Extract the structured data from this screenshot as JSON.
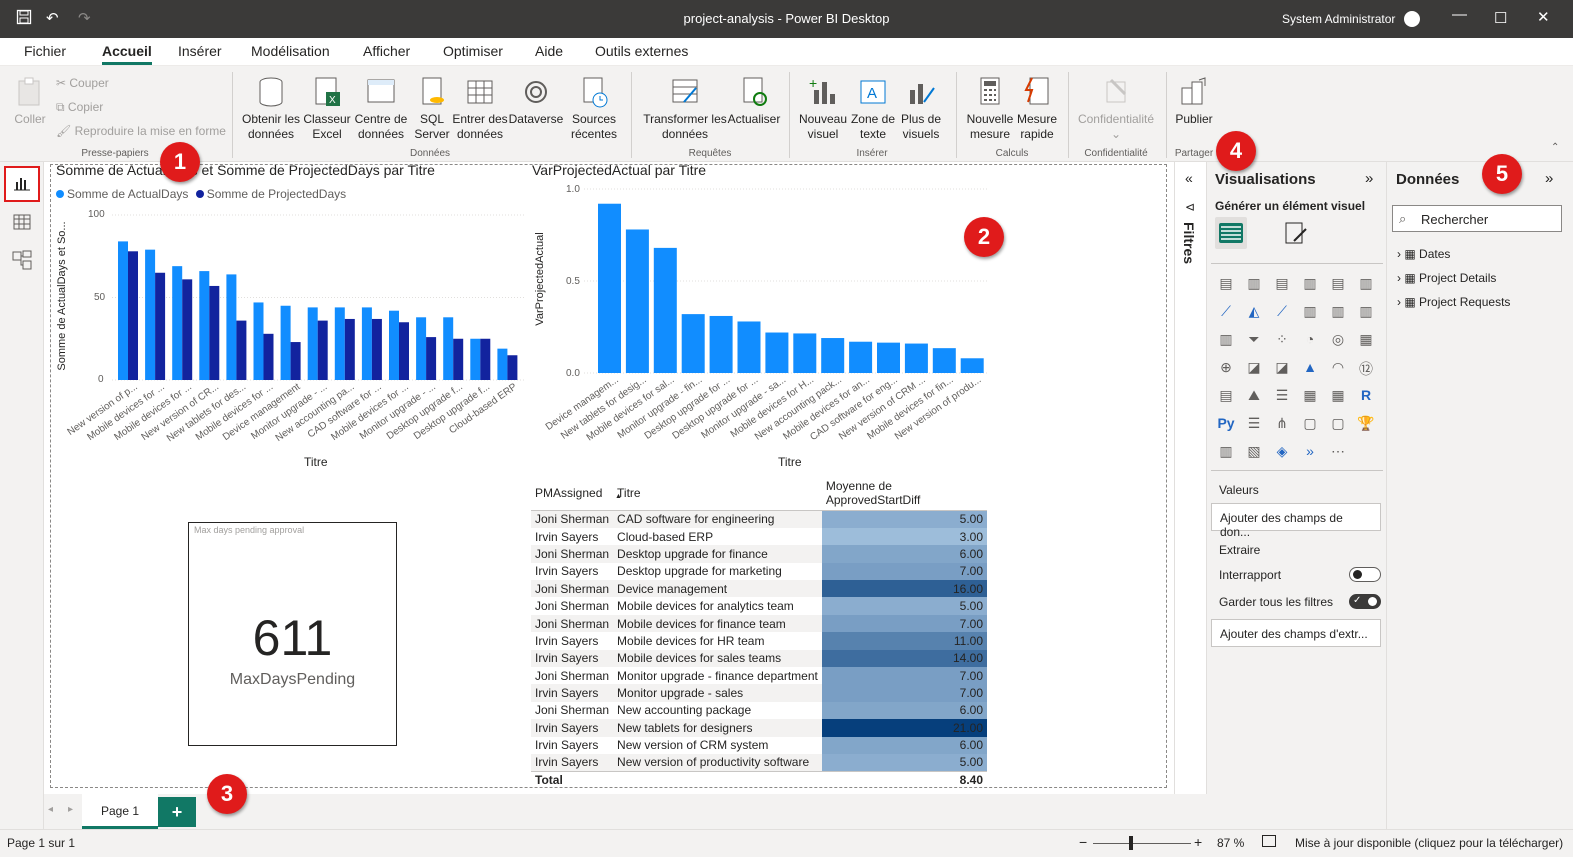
{
  "app": {
    "title": "project-analysis - Power BI Desktop",
    "user": "System Administrator"
  },
  "menu": [
    "Fichier",
    "Accueil",
    "Insérer",
    "Modélisation",
    "Afficher",
    "Optimiser",
    "Aide",
    "Outils externes"
  ],
  "ribbon": {
    "clipboard": {
      "paste": "Coller",
      "cut": "Couper",
      "copy": "Copier",
      "format": "Reproduire la mise en forme",
      "group": "Presse-papiers"
    },
    "data": {
      "get": "Obtenir les données",
      "excel": "Classeur Excel",
      "hub": "Centre de données",
      "sql": "SQL Server",
      "enter": "Entrer des données",
      "dataverse": "Dataverse",
      "recent": "Sources récentes",
      "group": "Données"
    },
    "queries": {
      "transform": "Transformer les données",
      "refresh": "Actualiser",
      "group": "Requêtes"
    },
    "insert": {
      "visual": "Nouveau visuel",
      "text": "Zone de texte",
      "more": "Plus de visuels",
      "group": "Insérer"
    },
    "calc": {
      "measure": "Nouvelle mesure",
      "quick": "Mesure rapide",
      "group": "Calculs"
    },
    "sens": {
      "label": "Confidentialité",
      "group": "Confidentialité"
    },
    "share": {
      "publish": "Publier",
      "group": "Partager"
    }
  },
  "chart1": {
    "title": "Somme de ActualDays et Somme de ProjectedDays par Titre",
    "legend": [
      "Somme de ActualDays",
      "Somme de ProjectedDays"
    ],
    "ylabel": "Somme de ActualDays et So...",
    "xlabel": "Titre",
    "yticks": [
      "100",
      "50",
      "0"
    ],
    "categories": [
      "New version of p...",
      "Mobile devices for ...",
      "Mobile devices for ...",
      "New version of CR...",
      "New tablets for des...",
      "Mobile devices for ...",
      "Device management",
      "Monitor upgrade - ...",
      "New accounting pa...",
      "CAD software for ...",
      "Mobile devices for ...",
      "Monitor upgrade - ...",
      "Desktop upgrade f...",
      "Desktop upgrade f...",
      "Cloud-based ERP"
    ]
  },
  "chart2": {
    "title": "VarProjectedActual par Titre",
    "ylabel": "VarProjectedActual",
    "xlabel": "Titre",
    "yticks": [
      "1.0",
      "0.5",
      "0.0"
    ],
    "categories": [
      "Device managem...",
      "New tablets for desig...",
      "Mobile devices for sal...",
      "Monitor upgrade - fin...",
      "Desktop upgrade for ...",
      "Desktop upgrade for ...",
      "Monitor upgrade - sa...",
      "Mobile devices for H...",
      "New accounting pack...",
      "Mobile devices for an...",
      "CAD software for eng...",
      "New version of CRM ...",
      "Mobile devices for fin...",
      "New version of produ..."
    ]
  },
  "chart_data": [
    {
      "type": "bar",
      "title": "Somme de ActualDays et Somme de ProjectedDays par Titre",
      "xlabel": "Titre",
      "ylabel": "Somme de ActualDays et So...",
      "ylim": [
        0,
        100
      ],
      "legend": "top-left",
      "categories": [
        "New version of p...",
        "Mobile devices for ...",
        "Mobile devices for ...",
        "New version of CR...",
        "New tablets for des...",
        "Mobile devices for ...",
        "Device management",
        "Monitor upgrade - ...",
        "New accounting pa...",
        "CAD software for ...",
        "Mobile devices for ...",
        "Monitor upgrade - ...",
        "Desktop upgrade f...",
        "Desktop upgrade f...",
        "Cloud-based ERP"
      ],
      "series": [
        {
          "name": "Somme de ActualDays",
          "color": "#118dff",
          "values": [
            84,
            79,
            69,
            66,
            64,
            47,
            45,
            44,
            44,
            44,
            42,
            38,
            38,
            25,
            19
          ]
        },
        {
          "name": "Somme de ProjectedDays",
          "color": "#12239e",
          "values": [
            78,
            65,
            61,
            57,
            36,
            28,
            23,
            36,
            37,
            37,
            35,
            26,
            25,
            25,
            15
          ]
        }
      ]
    },
    {
      "type": "bar",
      "title": "VarProjectedActual par Titre",
      "xlabel": "Titre",
      "ylabel": "VarProjectedActual",
      "ylim": [
        0,
        1.0
      ],
      "categories": [
        "Device managem...",
        "New tablets for desig...",
        "Mobile devices for sal...",
        "Monitor upgrade - fin...",
        "Desktop upgrade for ...",
        "Desktop upgrade for ...",
        "Monitor upgrade - sa...",
        "Mobile devices for H...",
        "New accounting pack...",
        "Mobile devices for an...",
        "CAD software for eng...",
        "New version of CRM ...",
        "Mobile devices for fin...",
        "New version of produ..."
      ],
      "series": [
        {
          "name": "VarProjectedActual",
          "color": "#118dff",
          "values": [
            0.92,
            0.78,
            0.68,
            0.32,
            0.31,
            0.28,
            0.22,
            0.215,
            0.19,
            0.17,
            0.165,
            0.16,
            0.135,
            0.08
          ]
        }
      ]
    }
  ],
  "card": {
    "header": "Max days pending approval",
    "value": "611",
    "label": "MaxDaysPending"
  },
  "table": {
    "headers": [
      "PMAssigned",
      "Titre",
      "Moyenne de ApprovedStartDiff"
    ],
    "rows": [
      [
        "Joni Sherman",
        "CAD software for engineering",
        "5.00"
      ],
      [
        "Irvin Sayers",
        "Cloud-based ERP",
        "3.00"
      ],
      [
        "Joni Sherman",
        "Desktop upgrade for finance",
        "6.00"
      ],
      [
        "Irvin Sayers",
        "Desktop upgrade for marketing",
        "7.00"
      ],
      [
        "Joni Sherman",
        "Device management",
        "16.00"
      ],
      [
        "Joni Sherman",
        "Mobile devices for analytics team",
        "5.00"
      ],
      [
        "Joni Sherman",
        "Mobile devices for finance team",
        "7.00"
      ],
      [
        "Irvin Sayers",
        "Mobile devices for HR team",
        "11.00"
      ],
      [
        "Irvin Sayers",
        "Mobile devices for sales teams",
        "14.00"
      ],
      [
        "Joni Sherman",
        "Monitor upgrade - finance department",
        "7.00"
      ],
      [
        "Irvin Sayers",
        "Monitor upgrade - sales",
        "7.00"
      ],
      [
        "Joni Sherman",
        "New accounting package",
        "6.00"
      ],
      [
        "Irvin Sayers",
        "New tablets for designers",
        "21.00"
      ],
      [
        "Irvin Sayers",
        "New version of CRM system",
        "6.00"
      ],
      [
        "Irvin Sayers",
        "New version of productivity software",
        "5.00"
      ]
    ],
    "total_label": "Total",
    "total_value": "8.40"
  },
  "pages": {
    "tab": "Page 1",
    "add": "+"
  },
  "status": {
    "page": "Page 1 sur 1",
    "zoom_minus": "−",
    "zoom_plus": "+",
    "zoom": "87 %",
    "update": "Mise à jour disponible (cliquez pour la télécharger)"
  },
  "filters": {
    "label": "Filtres"
  },
  "visualizations": {
    "title": "Visualisations",
    "subtitle": "Générer un élément visuel",
    "values_label": "Valeurs",
    "values_well": "Ajouter des champs de don...",
    "drill_label": "Extraire",
    "cross_report": "Interrapport",
    "keep_filters": "Garder tous les filtres",
    "drill_well": "Ajouter des champs d'extr..."
  },
  "data_pane": {
    "title": "Données",
    "search_placeholder": "Rechercher",
    "tables": [
      "Dates",
      "Project Details",
      "Project Requests"
    ]
  },
  "badges": [
    "1",
    "2",
    "3",
    "4",
    "5"
  ]
}
